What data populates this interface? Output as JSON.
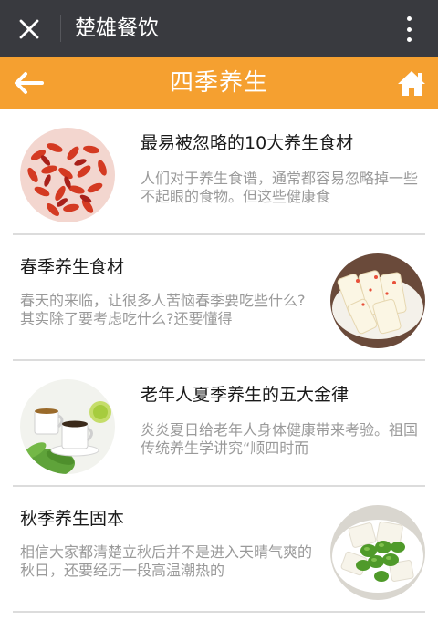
{
  "topbar": {
    "title": "楚雄餐饮",
    "close_icon": "close-icon",
    "more_icon": "more-vertical-icon",
    "bg_color": "#393a3f"
  },
  "header": {
    "title": "四季养生",
    "back_icon": "arrow-left-icon",
    "home_icon": "home-icon",
    "bg_color": "#f5a030"
  },
  "articles": [
    {
      "title": "最易被忽略的10大养生食材",
      "summary": "人们对于养生食谱，通常都容易忽略掉一些不起眼的食物。但这些健康食",
      "image": "goji-berries-image",
      "image_side": "left"
    },
    {
      "title": "春季养生食材",
      "summary": "春天的来临，让很多人苦恼春季要吃些什么?其实除了要考虑吃什么?还要懂得",
      "image": "yam-slices-image",
      "image_side": "right"
    },
    {
      "title": "老年人夏季养生的五大金律",
      "summary": "炎炎夏日给老年人身体健康带来考验。祖国传统养生学讲究“顺四时而",
      "image": "tea-cups-image",
      "image_side": "left"
    },
    {
      "title": "秋季养生固本",
      "summary": "相信大家都清楚立秋后并不是进入天晴气爽的秋日，还要经历一段高温潮热的",
      "image": "edamame-tofu-image",
      "image_side": "right"
    }
  ]
}
